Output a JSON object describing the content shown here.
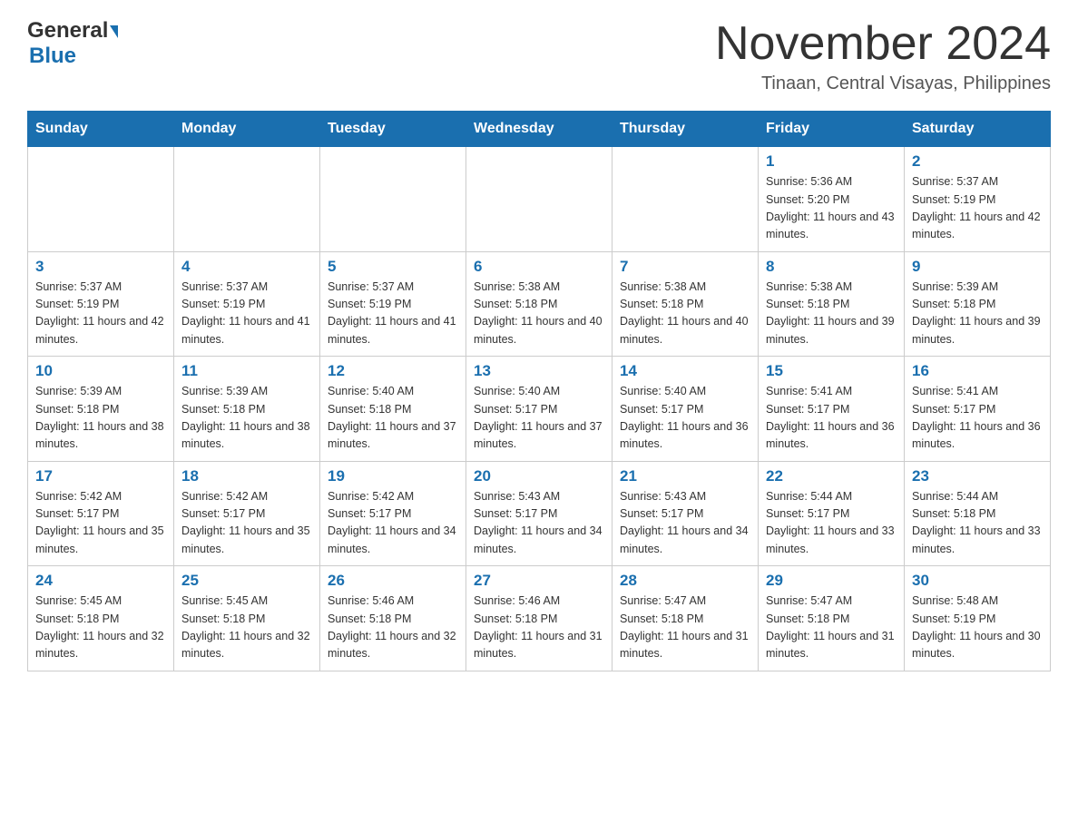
{
  "logo": {
    "line1": "General",
    "line2": "Blue"
  },
  "header": {
    "month_year": "November 2024",
    "location": "Tinaan, Central Visayas, Philippines"
  },
  "weekdays": [
    "Sunday",
    "Monday",
    "Tuesday",
    "Wednesday",
    "Thursday",
    "Friday",
    "Saturday"
  ],
  "weeks": [
    [
      {
        "day": "",
        "info": ""
      },
      {
        "day": "",
        "info": ""
      },
      {
        "day": "",
        "info": ""
      },
      {
        "day": "",
        "info": ""
      },
      {
        "day": "",
        "info": ""
      },
      {
        "day": "1",
        "info": "Sunrise: 5:36 AM\nSunset: 5:20 PM\nDaylight: 11 hours and 43 minutes."
      },
      {
        "day": "2",
        "info": "Sunrise: 5:37 AM\nSunset: 5:19 PM\nDaylight: 11 hours and 42 minutes."
      }
    ],
    [
      {
        "day": "3",
        "info": "Sunrise: 5:37 AM\nSunset: 5:19 PM\nDaylight: 11 hours and 42 minutes."
      },
      {
        "day": "4",
        "info": "Sunrise: 5:37 AM\nSunset: 5:19 PM\nDaylight: 11 hours and 41 minutes."
      },
      {
        "day": "5",
        "info": "Sunrise: 5:37 AM\nSunset: 5:19 PM\nDaylight: 11 hours and 41 minutes."
      },
      {
        "day": "6",
        "info": "Sunrise: 5:38 AM\nSunset: 5:18 PM\nDaylight: 11 hours and 40 minutes."
      },
      {
        "day": "7",
        "info": "Sunrise: 5:38 AM\nSunset: 5:18 PM\nDaylight: 11 hours and 40 minutes."
      },
      {
        "day": "8",
        "info": "Sunrise: 5:38 AM\nSunset: 5:18 PM\nDaylight: 11 hours and 39 minutes."
      },
      {
        "day": "9",
        "info": "Sunrise: 5:39 AM\nSunset: 5:18 PM\nDaylight: 11 hours and 39 minutes."
      }
    ],
    [
      {
        "day": "10",
        "info": "Sunrise: 5:39 AM\nSunset: 5:18 PM\nDaylight: 11 hours and 38 minutes."
      },
      {
        "day": "11",
        "info": "Sunrise: 5:39 AM\nSunset: 5:18 PM\nDaylight: 11 hours and 38 minutes."
      },
      {
        "day": "12",
        "info": "Sunrise: 5:40 AM\nSunset: 5:18 PM\nDaylight: 11 hours and 37 minutes."
      },
      {
        "day": "13",
        "info": "Sunrise: 5:40 AM\nSunset: 5:17 PM\nDaylight: 11 hours and 37 minutes."
      },
      {
        "day": "14",
        "info": "Sunrise: 5:40 AM\nSunset: 5:17 PM\nDaylight: 11 hours and 36 minutes."
      },
      {
        "day": "15",
        "info": "Sunrise: 5:41 AM\nSunset: 5:17 PM\nDaylight: 11 hours and 36 minutes."
      },
      {
        "day": "16",
        "info": "Sunrise: 5:41 AM\nSunset: 5:17 PM\nDaylight: 11 hours and 36 minutes."
      }
    ],
    [
      {
        "day": "17",
        "info": "Sunrise: 5:42 AM\nSunset: 5:17 PM\nDaylight: 11 hours and 35 minutes."
      },
      {
        "day": "18",
        "info": "Sunrise: 5:42 AM\nSunset: 5:17 PM\nDaylight: 11 hours and 35 minutes."
      },
      {
        "day": "19",
        "info": "Sunrise: 5:42 AM\nSunset: 5:17 PM\nDaylight: 11 hours and 34 minutes."
      },
      {
        "day": "20",
        "info": "Sunrise: 5:43 AM\nSunset: 5:17 PM\nDaylight: 11 hours and 34 minutes."
      },
      {
        "day": "21",
        "info": "Sunrise: 5:43 AM\nSunset: 5:17 PM\nDaylight: 11 hours and 34 minutes."
      },
      {
        "day": "22",
        "info": "Sunrise: 5:44 AM\nSunset: 5:17 PM\nDaylight: 11 hours and 33 minutes."
      },
      {
        "day": "23",
        "info": "Sunrise: 5:44 AM\nSunset: 5:18 PM\nDaylight: 11 hours and 33 minutes."
      }
    ],
    [
      {
        "day": "24",
        "info": "Sunrise: 5:45 AM\nSunset: 5:18 PM\nDaylight: 11 hours and 32 minutes."
      },
      {
        "day": "25",
        "info": "Sunrise: 5:45 AM\nSunset: 5:18 PM\nDaylight: 11 hours and 32 minutes."
      },
      {
        "day": "26",
        "info": "Sunrise: 5:46 AM\nSunset: 5:18 PM\nDaylight: 11 hours and 32 minutes."
      },
      {
        "day": "27",
        "info": "Sunrise: 5:46 AM\nSunset: 5:18 PM\nDaylight: 11 hours and 31 minutes."
      },
      {
        "day": "28",
        "info": "Sunrise: 5:47 AM\nSunset: 5:18 PM\nDaylight: 11 hours and 31 minutes."
      },
      {
        "day": "29",
        "info": "Sunrise: 5:47 AM\nSunset: 5:18 PM\nDaylight: 11 hours and 31 minutes."
      },
      {
        "day": "30",
        "info": "Sunrise: 5:48 AM\nSunset: 5:19 PM\nDaylight: 11 hours and 30 minutes."
      }
    ]
  ]
}
